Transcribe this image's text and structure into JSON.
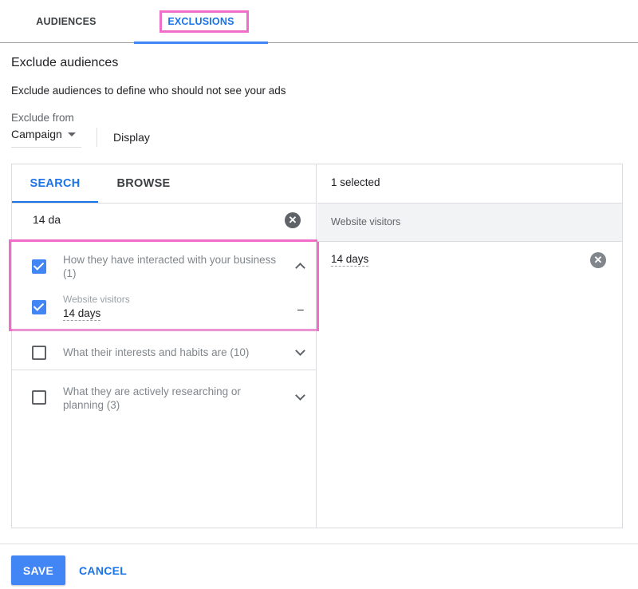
{
  "tabs": {
    "audiences": "AUDIENCES",
    "exclusions": "EXCLUSIONS"
  },
  "section": {
    "heading": "Exclude audiences",
    "description": "Exclude audiences to define who should not see your ads"
  },
  "exclude_from": {
    "label": "Exclude from",
    "level_value": "Campaign",
    "campaign_type": "Display"
  },
  "search_panel": {
    "tabs": {
      "search": "SEARCH",
      "browse": "BROWSE"
    },
    "query": "14 da",
    "categories": [
      {
        "label": "How they have interacted with your business (1)",
        "checked": true,
        "expanded": true,
        "sub_items": [
          {
            "group": "Website visitors",
            "value": "14 days",
            "checked": true,
            "action": "–"
          }
        ]
      },
      {
        "label": "What their interests and habits are (10)",
        "checked": false,
        "expanded": false
      },
      {
        "label": "What they are actively researching or planning (3)",
        "checked": false,
        "expanded": false
      }
    ]
  },
  "selected_panel": {
    "count_text": "1 selected",
    "group_header": "Website visitors",
    "items": [
      "14 days"
    ]
  },
  "footer": {
    "save": "SAVE",
    "cancel": "CANCEL"
  },
  "colors": {
    "accent": "#1a73e8",
    "primary_button": "#4285f4",
    "highlight": "#f06ec8"
  }
}
